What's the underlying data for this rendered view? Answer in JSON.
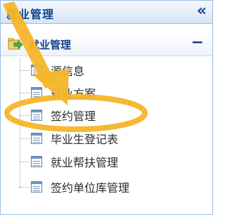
{
  "panel": {
    "title": "就业管理",
    "collapse_glyph": "«"
  },
  "section": {
    "title": "就业管理",
    "toggle_glyph": "−",
    "icon": "folder-arrow-icon"
  },
  "tree": {
    "items": [
      {
        "label": "源信息",
        "icon": "document-icon"
      },
      {
        "label": "就业方案",
        "icon": "document-icon"
      },
      {
        "label": "签约管理",
        "icon": "document-icon"
      },
      {
        "label": "毕业生登记表",
        "icon": "document-icon"
      },
      {
        "label": "就业帮扶管理",
        "icon": "document-icon"
      },
      {
        "label": "签约单位库管理",
        "icon": "document-icon"
      }
    ]
  },
  "annotation": {
    "arrow_color": "#f5b52a",
    "highlight_target": "签约管理"
  }
}
